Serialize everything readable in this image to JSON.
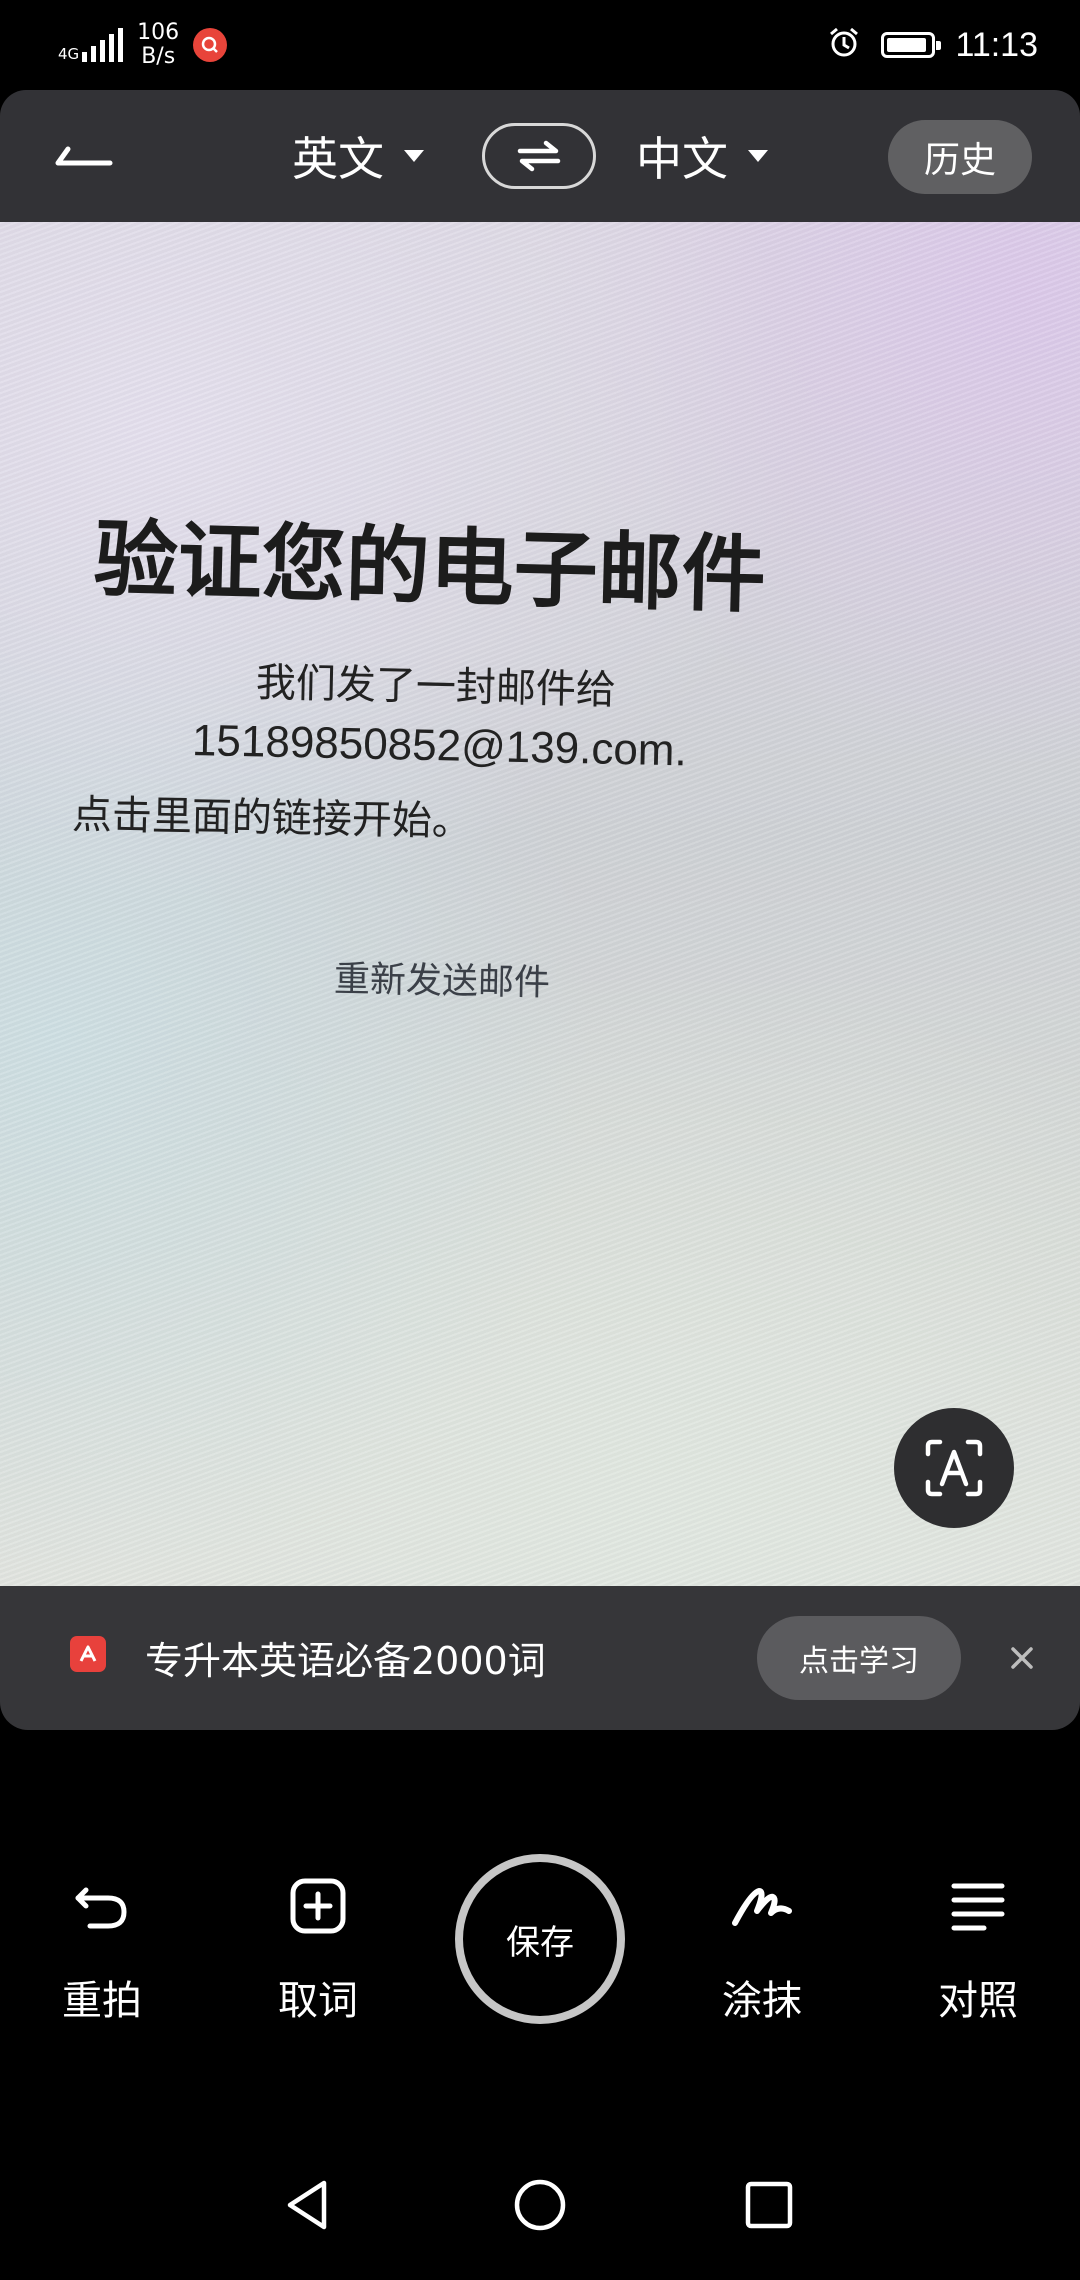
{
  "status_bar": {
    "network": "4G",
    "speed_value": "106",
    "speed_unit": "B/s",
    "time": "11:13",
    "battery_level": 0.8,
    "icons": [
      "signal-icon",
      "app-notification-icon",
      "alarm-icon",
      "battery-icon"
    ]
  },
  "top_bar": {
    "source_language": "英文",
    "target_language": "中文",
    "history_label": "历史",
    "icons": [
      "back-arrow-icon",
      "caret-down-icon",
      "swap-icon"
    ]
  },
  "photo": {
    "title": "验证您的电子邮件",
    "line1": "我们发了一封邮件给",
    "email": "15189850852@139.com.",
    "line3": "点击里面的链接开始。",
    "resend": "重新发送邮件",
    "ocr_icon": "text-recognition-icon"
  },
  "banner": {
    "text": "专升本英语必备2000词",
    "button_label": "点击学习",
    "logo_color": "#e8413c"
  },
  "toolbar": {
    "retake_label": "重拍",
    "pick_word_label": "取词",
    "save_label": "保存",
    "erase_label": "涂抹",
    "compare_label": "对照"
  },
  "nav_bar": {
    "icons": [
      "back-triangle-icon",
      "home-circle-icon",
      "recents-square-icon"
    ]
  }
}
